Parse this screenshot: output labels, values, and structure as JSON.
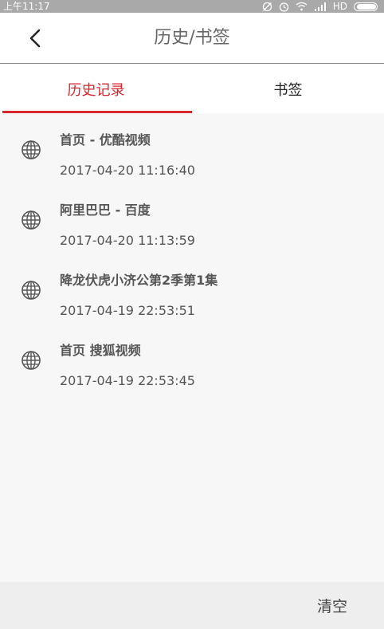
{
  "status_bar": {
    "time": "上午11:17",
    "network_label": "HD",
    "icons": [
      "sync-off-icon",
      "alarm-icon",
      "wifi-icon",
      "signal-icon",
      "battery-icon"
    ]
  },
  "header": {
    "title": "历史/书签",
    "back_icon": "chevron-left-icon"
  },
  "tabs": [
    {
      "label": "历史记录",
      "active": true
    },
    {
      "label": "书签",
      "active": false
    }
  ],
  "history": [
    {
      "title": "首页 - 优酷视频",
      "time": "2017-04-20 11:16:40",
      "icon": "globe-icon"
    },
    {
      "title": "阿里巴巴 - 百度",
      "time": "2017-04-20 11:13:59",
      "icon": "globe-icon"
    },
    {
      "title": "降龙伏虎小济公第2季第1集",
      "time": "2017-04-19 22:53:51",
      "icon": "globe-icon"
    },
    {
      "title": "首页 搜狐视频",
      "time": "2017-04-19 22:53:45",
      "icon": "globe-icon"
    }
  ],
  "footer": {
    "clear_label": "清空"
  },
  "colors": {
    "accent": "#d7262e",
    "status_bar": "#a9a9a9",
    "list_background": "#f7f7f7",
    "footer_background": "#eeeeee"
  }
}
